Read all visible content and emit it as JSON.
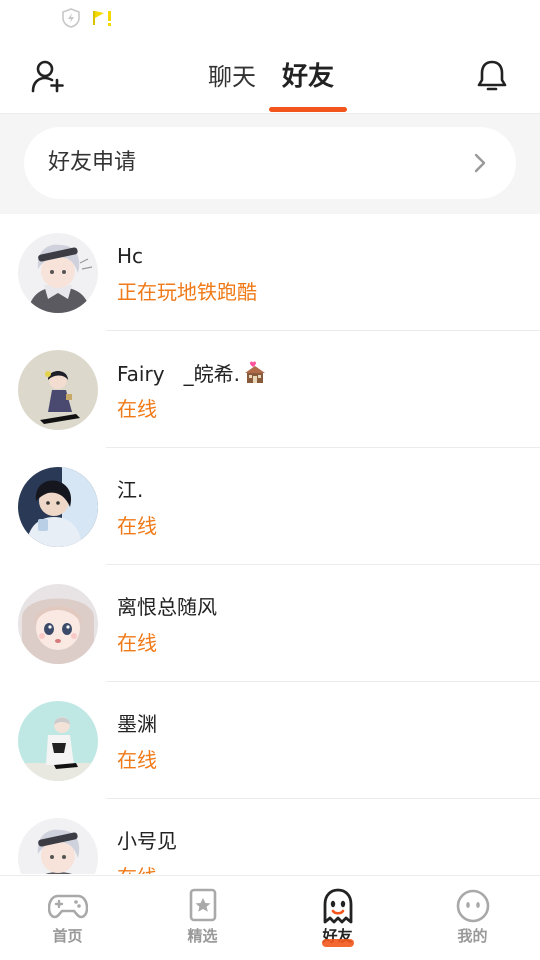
{
  "top_tabs": {
    "chat": "聊天",
    "friends": "好友"
  },
  "friend_request": {
    "label": "好友申请"
  },
  "friends": [
    {
      "name": "Hc",
      "status": "正在玩地铁跑酷"
    },
    {
      "name": "Fairy   _皖希.",
      "status": "在线"
    },
    {
      "name": "江.",
      "status": "在线"
    },
    {
      "name": "离恨总随风",
      "status": "在线"
    },
    {
      "name": "墨渊",
      "status": "在线"
    },
    {
      "name": "小号见",
      "status": "在线"
    }
  ],
  "bottom_nav": [
    {
      "label": "首页",
      "icon": "gamepad-icon"
    },
    {
      "label": "精选",
      "icon": "star-bookmark-icon"
    },
    {
      "label": "好友",
      "icon": "ghost-icon"
    },
    {
      "label": "我的",
      "icon": "face-icon"
    }
  ],
  "colors": {
    "accent": "#f2561d",
    "status_orange": "#f07a18",
    "background_band": "#f5f5f6"
  }
}
